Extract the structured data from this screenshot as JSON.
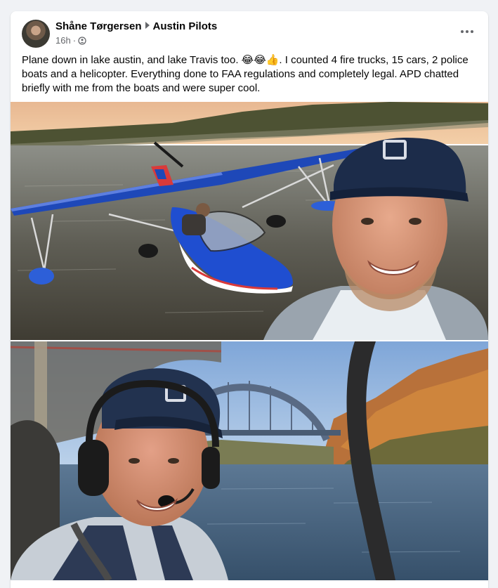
{
  "post": {
    "author": "Shåne Tørgersen",
    "group": "Austin Pilots",
    "time": "16h",
    "privacy_dot": "·",
    "body": "Plane down in lake austin, and lake Travis too. 😂😂👍. I counted 4 fire trucks, 15 cars, 2 police boats and a helicopter. Everything done to FAA regulations and completely legal. APD chatted briefly with me from the boats and were super cool."
  },
  "icons": {
    "privacy": "group-members-icon",
    "caret": "caret-right-icon",
    "more": "more-options-icon"
  },
  "colors": {
    "background": "#f0f2f5",
    "card": "#ffffff",
    "meta_text": "#65676b"
  }
}
